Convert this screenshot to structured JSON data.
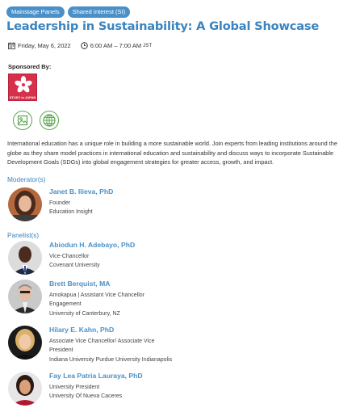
{
  "tags": [
    "Mainstage Panels",
    "Shared Interest (SI)"
  ],
  "title": "Leadership in Sustainability: A Global Showcase",
  "meta": {
    "date": "Friday, May 6, 2022",
    "time": "6:00 AM – 7:00 AM",
    "timezone": "JST"
  },
  "sponsor": {
    "heading": "Sponsored By:",
    "logo_text": "STUDY in JAPAN"
  },
  "icons": {
    "web_icon": "image-link-icon",
    "globe_icon": "globe-icon"
  },
  "description": "International education has a unique role in building a more sustainable world. Join experts from leading institutions around the globe as they share model practices in international education and sustainability and discuss ways to incorporate Sustainable Development Goals (SDGs) into global engagement strategies for greater access, growth, and impact.",
  "moderator_heading": "Moderator(s)",
  "moderators": [
    {
      "name": "Janet B. Ilieva, PhD",
      "lines": [
        "Founder",
        "Education Insight"
      ]
    }
  ],
  "panelist_heading": "Panelist(s)",
  "panelists": [
    {
      "name": "Abiodun H. Adebayo, PhD",
      "lines": [
        "Vice-Chancellor",
        "Covenant University"
      ]
    },
    {
      "name": "Brett Berquist, MA",
      "lines": [
        "Amokapua | Assistant Vice Chancellor",
        "Engagement",
        "University of Canterbury, NZ"
      ]
    },
    {
      "name": "Hilary E. Kahn, PhD",
      "lines": [
        "Associate Vice Chancellor/ Associate Vice",
        "President",
        "Indiana University Purdue University Indianapolis"
      ]
    },
    {
      "name": "Fay Lea Patria Lauraya, PhD",
      "lines": [
        "University President",
        "University Of Nueva Caceres"
      ]
    }
  ],
  "colors": {
    "accent": "#3a84c1",
    "tag_bg": "#4a90c8",
    "sponsor_red": "#d6304a",
    "icon_green": "#5aa64a"
  }
}
